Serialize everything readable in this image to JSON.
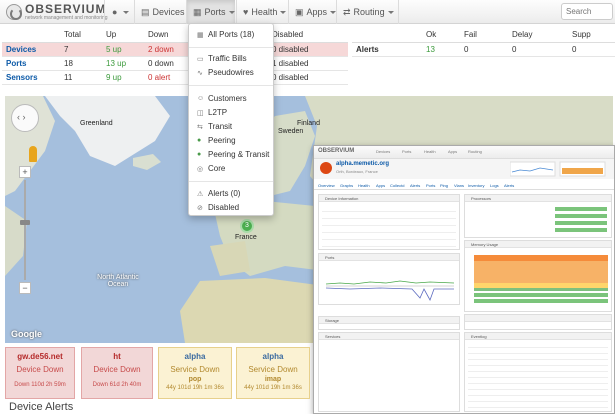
{
  "navbar": {
    "logo_title": "OBSERVIUM",
    "logo_sub": "network management and monitoring",
    "globe_label": "",
    "devices": "Devices",
    "ports": "Ports",
    "health": "Health",
    "apps": "Apps",
    "routing": "Routing",
    "search_placeholder": "Search"
  },
  "summary": {
    "headers": [
      "",
      "Total",
      "Up",
      "Down",
      "Disabled"
    ],
    "rows": [
      {
        "label": "Devices",
        "total": "7",
        "up": "5 up",
        "down": "2 down",
        "disabled": "0 disabled"
      },
      {
        "label": "Ports",
        "total": "18",
        "up": "13 up",
        "down": "0 down",
        "disabled": "1 disabled"
      },
      {
        "label": "Sensors",
        "total": "11",
        "up": "9 up",
        "down": "0 alert",
        "disabled": "0 disabled"
      }
    ]
  },
  "alerts_table": {
    "headers": [
      "",
      "Ok",
      "Fail",
      "Delay",
      "Supp"
    ],
    "row": {
      "label": "Alerts",
      "ok": "13",
      "fail": "0",
      "delay": "0",
      "supp": "0"
    }
  },
  "ports_menu": {
    "items": [
      {
        "label": "All Ports (18)",
        "icon": "port-icon"
      },
      {
        "label": "Traffic Bills",
        "icon": "bill-icon"
      },
      {
        "label": "Pseudowires",
        "icon": "pseudowire-icon"
      },
      {
        "label": "Customers",
        "icon": "customer-icon"
      },
      {
        "label": "L2TP",
        "icon": "l2tp-icon"
      },
      {
        "label": "Transit",
        "icon": "transit-icon"
      },
      {
        "label": "Peering",
        "icon": "peering-icon"
      },
      {
        "label": "Peering & Transit",
        "icon": "peering-transit-icon"
      },
      {
        "label": "Core",
        "icon": "core-icon"
      },
      {
        "label": "Alerts (0)",
        "icon": "alert-icon"
      },
      {
        "label": "Disabled",
        "icon": "disabled-icon"
      }
    ]
  },
  "map": {
    "labels": [
      "Greenland",
      "Sweden",
      "Finland",
      "France",
      "North Atlantic Ocean",
      "Google"
    ],
    "cluster_count": "3"
  },
  "overlay": {
    "logo": "OBSERVIUM",
    "hostname": "alpha.memetic.org",
    "location": "Orth, Bordeaux, France",
    "nav": [
      "Devices",
      "Ports",
      "Health",
      "Apps",
      "Routing"
    ],
    "tabs": [
      "Overview",
      "Graphs",
      "Health",
      "Apps",
      "Collectd",
      "Alerts",
      "Ports",
      "Ping",
      "Vlans",
      "Inventory",
      "Logs",
      "Alerts"
    ],
    "panels": [
      "Device Information",
      "Processors",
      "Memory Usage",
      "Ports",
      "Storage",
      "Services",
      "Eventlog"
    ]
  },
  "status_boxes": [
    {
      "host": "gw.de56.net",
      "status": "Device Down",
      "detail": "",
      "duration": "Down 110d 2h 59m",
      "level": "red"
    },
    {
      "host": "ht",
      "status": "Device Down",
      "detail": "",
      "duration": "Down 61d 2h 40m",
      "level": "red"
    },
    {
      "host": "alpha",
      "status": "Service Down",
      "detail": "pop",
      "duration": "44y 101d 19h 1m 36s",
      "level": "yellow"
    },
    {
      "host": "alpha",
      "status": "Service Down",
      "detail": "imap",
      "duration": "44y 101d 19h 1m 36s",
      "level": "yellow"
    }
  ],
  "device_alerts_heading": "Device Alerts"
}
